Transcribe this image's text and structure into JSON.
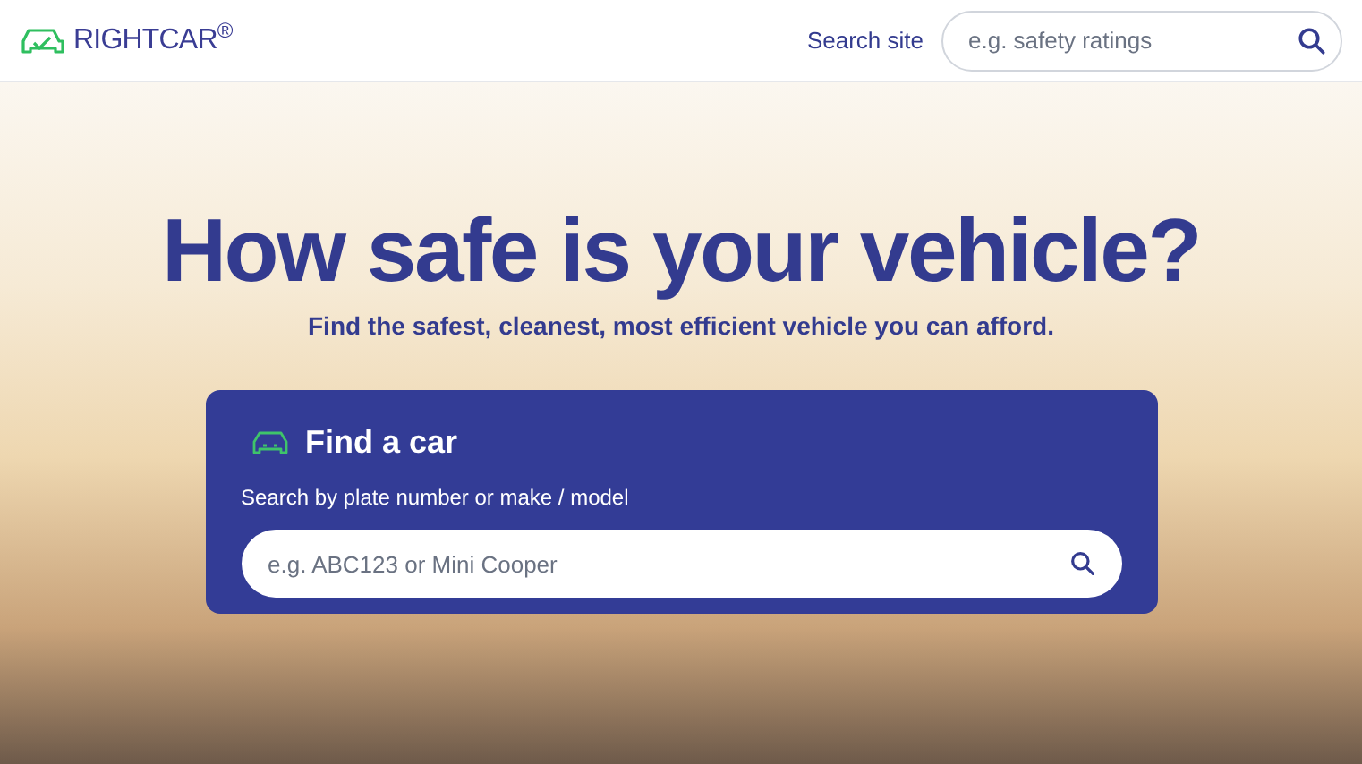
{
  "header": {
    "logo": "RIGHTCAR$^{®}$",
    "search_label": "Search site",
    "search": {
      "placeholder": "e.g. safety ratings"
    }
  },
  "hero": {
    "title": "How safe is your vehicle?",
    "subtitle": "Find the safest, cleanest, most efficient vehicle you can afford.",
    "finder": {
      "title": "Find a car",
      "hint": "Search by plate number or make / model",
      "search": {
        "placeholder": "e.g. ABC123 or Mini Cooper"
      }
    }
  }
}
